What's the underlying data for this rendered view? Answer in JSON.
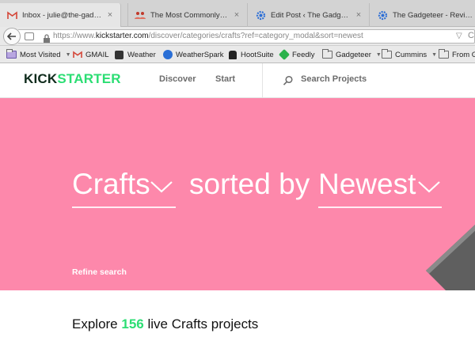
{
  "browser": {
    "tabs": [
      {
        "icon": "gmail-icon",
        "title": "Inbox - julie@the-gadgete...",
        "close": "×"
      },
      {
        "icon": "people-icon",
        "title": "The Most Commonly-Use...",
        "close": "×"
      },
      {
        "icon": "gear-blue-icon",
        "title": "Edit Post ‹ The Gadgeteer ...",
        "close": "×"
      },
      {
        "icon": "gear-blue-icon",
        "title": "The Gadgeteer - Reviewin...",
        "close": ""
      }
    ],
    "url_prefix": "https://www.",
    "url_domain": "kickstarter.com",
    "url_suffix": "/discover/categories/crafts?ref=category_modal&sort=newest",
    "url_dropdown": "▽",
    "url_reload": "C",
    "bookmarks": [
      {
        "label": "Most Visited",
        "icon": "folder-purple-icon",
        "dropdown": "▼"
      },
      {
        "label": "GMAIL",
        "icon": "gmail-icon",
        "dropdown": ""
      },
      {
        "label": "Weather",
        "icon": "weather-icon",
        "dropdown": ""
      },
      {
        "label": "WeatherSpark",
        "icon": "weatherspark-icon",
        "dropdown": ""
      },
      {
        "label": "HootSuite",
        "icon": "hootsuite-icon",
        "dropdown": ""
      },
      {
        "label": "Feedly",
        "icon": "feedly-icon",
        "dropdown": ""
      },
      {
        "label": "Gadgeteer",
        "icon": "folder-icon",
        "dropdown": "▼"
      },
      {
        "label": "Cummins",
        "icon": "folder-icon",
        "dropdown": "▼"
      },
      {
        "label": "From G",
        "icon": "folder-icon",
        "dropdown": ""
      }
    ]
  },
  "site": {
    "logo_part1": "KICK",
    "logo_part2": "STARTER",
    "nav_discover": "Discover",
    "nav_start": "Start",
    "search_label": "Search Projects"
  },
  "hero": {
    "category": "Crafts",
    "middle_text": "sorted by",
    "sort": "Newest",
    "refine": "Refine search",
    "background": "#fd88ab"
  },
  "explore": {
    "prefix": "Explore",
    "count": "156",
    "suffix": "live Crafts projects"
  },
  "colors": {
    "brand_green": "#2bde73",
    "hero_pink": "#fd88ab"
  }
}
